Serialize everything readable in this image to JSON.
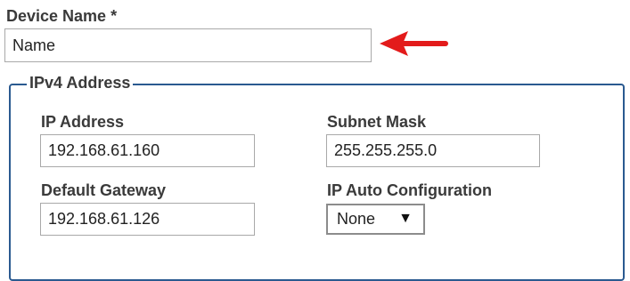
{
  "device_name": {
    "label": "Device Name *",
    "value": "Name"
  },
  "annotation": {
    "icon": "red-arrow-left-icon",
    "color": "#e31b1b"
  },
  "ipv4": {
    "legend": "IPv4 Address",
    "border_color": "#2a5a90",
    "ip_address": {
      "label": "IP Address",
      "value": "192.168.61.160"
    },
    "subnet_mask": {
      "label": "Subnet Mask",
      "value": "255.255.255.0"
    },
    "default_gateway": {
      "label": "Default Gateway",
      "value": "192.168.61.126"
    },
    "ip_auto_configuration": {
      "label": "IP Auto Configuration",
      "selected": "None",
      "arrow_glyph": "▼"
    }
  }
}
